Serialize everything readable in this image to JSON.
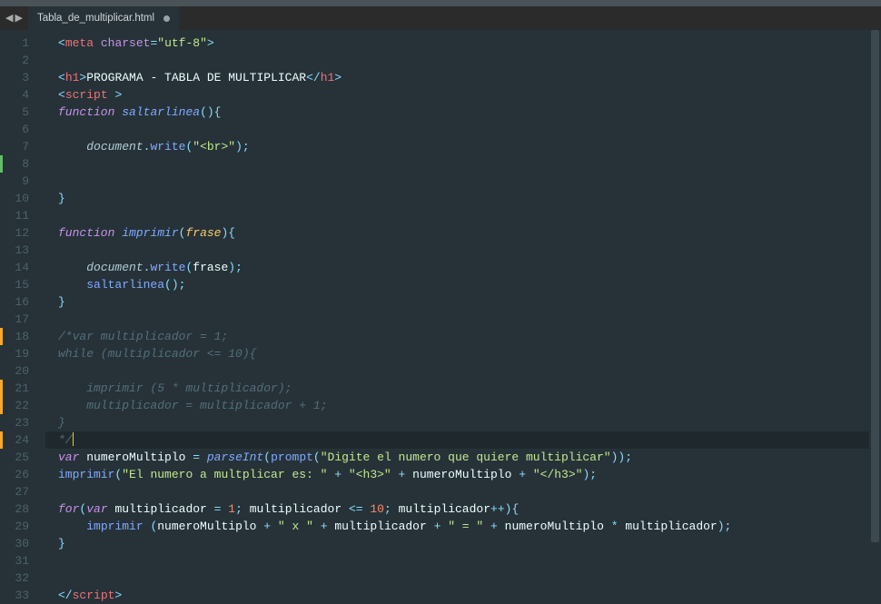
{
  "tab": {
    "title": "Tabla_de_multiplicar.html",
    "modified": true
  },
  "gutter": {
    "lines": 33,
    "markedOrange": [
      18,
      21,
      22,
      24
    ],
    "markedGreen": [
      8
    ]
  },
  "code": {
    "currentLine": 24,
    "tokens": [
      [
        [
          "brk",
          "<"
        ],
        [
          "tag",
          "meta"
        ],
        [
          "txt",
          " "
        ],
        [
          "attr",
          "charset"
        ],
        [
          "op",
          "="
        ],
        [
          "str",
          "\"utf-8\""
        ],
        [
          "brk",
          ">"
        ]
      ],
      [],
      [
        [
          "brk",
          "<"
        ],
        [
          "tag",
          "h1"
        ],
        [
          "brk",
          ">"
        ],
        [
          "txt",
          "PROGRAMA - TABLA DE MULTIPLICAR"
        ],
        [
          "brk",
          "</"
        ],
        [
          "tag",
          "h1"
        ],
        [
          "brk",
          ">"
        ]
      ],
      [
        [
          "brk",
          "<"
        ],
        [
          "tag",
          "script"
        ],
        [
          "txt",
          " "
        ],
        [
          "brk",
          ">"
        ]
      ],
      [
        [
          "kw",
          "function"
        ],
        [
          "txt",
          " "
        ],
        [
          "fn",
          "saltarlinea"
        ],
        [
          "punc",
          "()"
        ],
        [
          "punc",
          "{"
        ]
      ],
      [],
      [
        [
          "txt",
          "    "
        ],
        [
          "obj",
          "document"
        ],
        [
          "punc",
          "."
        ],
        [
          "fncall",
          "write"
        ],
        [
          "punc",
          "("
        ],
        [
          "str",
          "\"<br>\""
        ],
        [
          "punc",
          ")"
        ],
        [
          "punc",
          ";"
        ]
      ],
      [],
      [],
      [
        [
          "punc",
          "}"
        ]
      ],
      [],
      [
        [
          "kw",
          "function"
        ],
        [
          "txt",
          " "
        ],
        [
          "fn",
          "imprimir"
        ],
        [
          "punc",
          "("
        ],
        [
          "param",
          "frase"
        ],
        [
          "punc",
          ")"
        ],
        [
          "punc",
          "{"
        ]
      ],
      [],
      [
        [
          "txt",
          "    "
        ],
        [
          "obj",
          "document"
        ],
        [
          "punc",
          "."
        ],
        [
          "fncall",
          "write"
        ],
        [
          "punc",
          "("
        ],
        [
          "varn",
          "frase"
        ],
        [
          "punc",
          ")"
        ],
        [
          "punc",
          ";"
        ]
      ],
      [
        [
          "txt",
          "    "
        ],
        [
          "fncall",
          "saltarlinea"
        ],
        [
          "punc",
          "()"
        ],
        [
          "punc",
          ";"
        ]
      ],
      [
        [
          "punc",
          "}"
        ]
      ],
      [],
      [
        [
          "cmt",
          "/*var multiplicador = 1;"
        ]
      ],
      [
        [
          "cmt",
          "while (multiplicador <= 10){"
        ]
      ],
      [],
      [
        [
          "cmt",
          "    imprimir (5 * multiplicador);"
        ]
      ],
      [
        [
          "cmt",
          "    multiplicador = multiplicador + 1;"
        ]
      ],
      [
        [
          "cmt",
          "}"
        ]
      ],
      [
        [
          "cmt",
          "*/"
        ],
        [
          "cursor",
          ""
        ]
      ],
      [
        [
          "kw",
          "var"
        ],
        [
          "txt",
          " "
        ],
        [
          "varn",
          "numeroMultiplo "
        ],
        [
          "op",
          "="
        ],
        [
          "txt",
          " "
        ],
        [
          "fn",
          "parseInt"
        ],
        [
          "punc",
          "("
        ],
        [
          "fncall",
          "prompt"
        ],
        [
          "punc",
          "("
        ],
        [
          "str",
          "\"Digite el numero que quiere multiplicar\""
        ],
        [
          "punc",
          "))"
        ],
        [
          "punc",
          ";"
        ]
      ],
      [
        [
          "fncall",
          "imprimir"
        ],
        [
          "punc",
          "("
        ],
        [
          "str",
          "\"El numero a multplicar es: \""
        ],
        [
          "txt",
          " "
        ],
        [
          "op",
          "+"
        ],
        [
          "txt",
          " "
        ],
        [
          "str",
          "\"<h3>\""
        ],
        [
          "txt",
          " "
        ],
        [
          "op",
          "+"
        ],
        [
          "txt",
          " "
        ],
        [
          "varn",
          "numeroMultiplo "
        ],
        [
          "op",
          "+"
        ],
        [
          "txt",
          " "
        ],
        [
          "str",
          "\"</h3>\""
        ],
        [
          "punc",
          ")"
        ],
        [
          "punc",
          ";"
        ]
      ],
      [],
      [
        [
          "kw",
          "for"
        ],
        [
          "punc",
          "("
        ],
        [
          "kw",
          "var"
        ],
        [
          "txt",
          " "
        ],
        [
          "varn",
          "multiplicador "
        ],
        [
          "op",
          "="
        ],
        [
          "txt",
          " "
        ],
        [
          "num",
          "1"
        ],
        [
          "punc",
          ";"
        ],
        [
          "txt",
          " "
        ],
        [
          "varn",
          "multiplicador "
        ],
        [
          "op",
          "<="
        ],
        [
          "txt",
          " "
        ],
        [
          "num",
          "10"
        ],
        [
          "punc",
          ";"
        ],
        [
          "txt",
          " "
        ],
        [
          "varn",
          "multiplicador"
        ],
        [
          "op",
          "++"
        ],
        [
          "punc",
          ")"
        ],
        [
          "punc",
          "{"
        ]
      ],
      [
        [
          "txt",
          "    "
        ],
        [
          "fncall",
          "imprimir "
        ],
        [
          "punc",
          "("
        ],
        [
          "varn",
          "numeroMultiplo "
        ],
        [
          "op",
          "+"
        ],
        [
          "txt",
          " "
        ],
        [
          "str",
          "\" x \""
        ],
        [
          "txt",
          " "
        ],
        [
          "op",
          "+"
        ],
        [
          "txt",
          " "
        ],
        [
          "varn",
          "multiplicador "
        ],
        [
          "op",
          "+"
        ],
        [
          "txt",
          " "
        ],
        [
          "str",
          "\" = \""
        ],
        [
          "txt",
          " "
        ],
        [
          "op",
          "+"
        ],
        [
          "txt",
          " "
        ],
        [
          "varn",
          "numeroMultiplo "
        ],
        [
          "op",
          "*"
        ],
        [
          "txt",
          " "
        ],
        [
          "varn",
          "multiplicador"
        ],
        [
          "punc",
          ")"
        ],
        [
          "punc",
          ";"
        ]
      ],
      [
        [
          "punc",
          "}"
        ]
      ],
      [],
      [],
      [
        [
          "brk",
          "</"
        ],
        [
          "tag",
          "script"
        ],
        [
          "brk",
          ">"
        ]
      ]
    ]
  }
}
